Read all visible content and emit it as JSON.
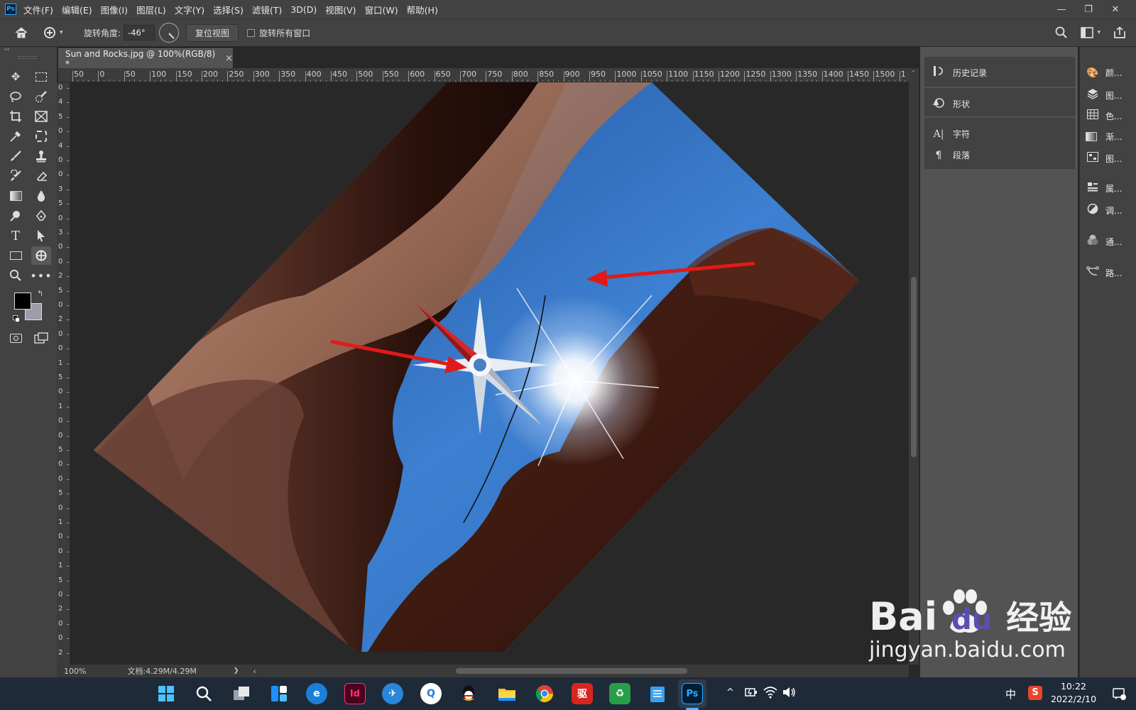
{
  "app": {
    "logo": "Ps",
    "window_controls": [
      "—",
      "❐",
      "✕"
    ]
  },
  "menu": [
    "文件(F)",
    "编辑(E)",
    "图像(I)",
    "图层(L)",
    "文字(Y)",
    "选择(S)",
    "滤镜(T)",
    "3D(D)",
    "视图(V)",
    "窗口(W)",
    "帮助(H)"
  ],
  "options": {
    "rotate_label": "旋转角度:",
    "rotate_value": "-46°",
    "reset_view": "复位视图",
    "rotate_all_windows": "旋转所有窗口",
    "rotate_all_checked": false
  },
  "document": {
    "tab_title": "Sun and Rocks.jpg @ 100%(RGB/8) *",
    "close": "×"
  },
  "ruler_top_labels": [
    "50",
    "0",
    "50",
    "100",
    "150",
    "200",
    "250",
    "300",
    "350",
    "400",
    "450",
    "500",
    "550",
    "600",
    "650",
    "700",
    "750",
    "800",
    "850",
    "900",
    "950",
    "1000",
    "1050",
    "1100",
    "1150",
    "1200",
    "1250",
    "1300",
    "1350",
    "1400",
    "1450",
    "1500",
    "1"
  ],
  "ruler_left_labels": [
    "0",
    "4",
    "5",
    "0",
    "4",
    "0",
    "0",
    "3",
    "5",
    "0",
    "3",
    "0",
    "0",
    "2",
    "5",
    "0",
    "2",
    "0",
    "0",
    "1",
    "5",
    "0",
    "1",
    "0",
    "0",
    "5",
    "0",
    "0",
    "5",
    "0",
    "1",
    "0",
    "0",
    "1",
    "5",
    "0",
    "2",
    "0",
    "0",
    "2"
  ],
  "status": {
    "zoom": "100%",
    "doc_info": "文档:4.29M/4.29M",
    "arrow": "❯",
    "scroll_left": "‹"
  },
  "panel_right": {
    "items": [
      {
        "icon": "history-icon",
        "label": "历史记录"
      },
      {
        "icon": "shapes-icon",
        "label": "形状"
      },
      {
        "icon": "character-icon",
        "label": "字符"
      },
      {
        "icon": "paragraph-icon",
        "label": "段落"
      }
    ]
  },
  "panel_far_right": {
    "items": [
      {
        "icon": "color-icon",
        "label": "颜..."
      },
      {
        "icon": "layers-icon",
        "label": "图..."
      },
      {
        "icon": "swatches-icon",
        "label": "色..."
      },
      {
        "icon": "gradient-icon",
        "label": "渐..."
      },
      {
        "icon": "patterns-icon",
        "label": "图..."
      },
      {
        "icon": "properties-icon",
        "label": "属..."
      },
      {
        "icon": "adjustments-icon",
        "label": "调..."
      },
      {
        "icon": "channels-icon",
        "label": "通..."
      },
      {
        "icon": "paths-icon",
        "label": "路..."
      }
    ]
  },
  "taskbar": {
    "time": "10:22",
    "date": "2022/2/10",
    "ime": "中",
    "apps": [
      "windows-start",
      "search",
      "task-view",
      "widgets",
      "edge",
      "indesign",
      "feishu",
      "qq-browser",
      "qq",
      "file-explorer",
      "chrome",
      "app-red",
      "recycle",
      "notepad",
      "photoshop"
    ]
  },
  "watermark": {
    "brand": "Bai",
    "brand2": "du",
    "brand_cn": "经验",
    "url": "jingyan.baidu.com"
  },
  "colors": {
    "accent": "#31a8ff",
    "arrow": "#e01a1a",
    "sky": "#2d6fc0"
  }
}
